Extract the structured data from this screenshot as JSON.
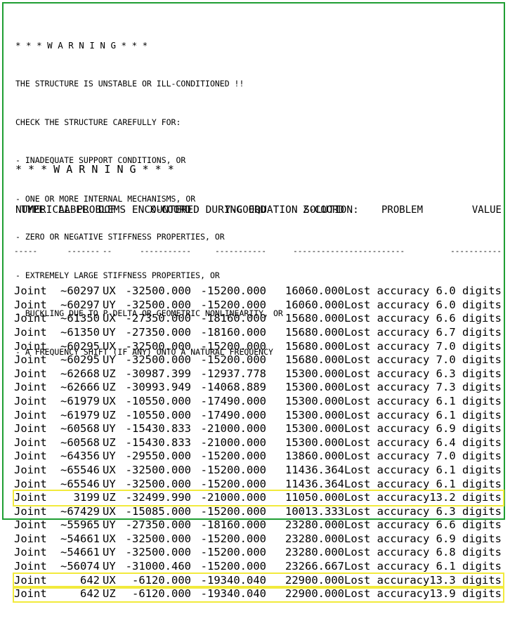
{
  "warning1": {
    "title": "* * * W A R N I N G * * *",
    "lines": [
      "THE STRUCTURE IS UNSTABLE OR ILL-CONDITIONED !!",
      "CHECK THE STRUCTURE CAREFULLY FOR:",
      "- INADEQUATE SUPPORT CONDITIONS, OR",
      "- ONE OR MORE INTERNAL MECHANISMS, OR",
      "- ZERO OR NEGATIVE STIFFNESS PROPERTIES, OR",
      "- EXTREMELY LARGE STIFFNESS PROPERTIES, OR",
      "- BUCKLING DUE TO P-DELTA OR GEOMETRIC NONLINEARITY, OR",
      "- A FREQUENCY SHIFT (IF ANY) ONTO A NATURAL FREQUENCY"
    ]
  },
  "warning2": {
    "title": "* * * W A R N I N G * * *",
    "message": "NUMERICAL PROBLEMS ENCOUNTERED DURING EQUATION SOLUTION:"
  },
  "table": {
    "headers": {
      "type": "TYPE",
      "label": "LABEL",
      "dof": "DOF",
      "x": "X-COORD",
      "y": "Y-COORD",
      "z": "Z-COORD",
      "problem": "PROBLEM",
      "value": "VALUE"
    },
    "separator": {
      "type": "-----",
      "label": "-------",
      "dof": "--",
      "x": "-----------",
      "y": "-----------",
      "z": "-----------",
      "problem": "-------------",
      "value": "-----------"
    },
    "rows": [
      {
        "type": "Joint",
        "label": "~60297",
        "dof": "UX",
        "x": "-32500.000",
        "y": "-15200.000",
        "z": "16060.000",
        "problem": "Lost accuracy",
        "value": "6.0 digits",
        "highlight": false
      },
      {
        "type": "Joint",
        "label": "~60297",
        "dof": "UY",
        "x": "-32500.000",
        "y": "-15200.000",
        "z": "16060.000",
        "problem": "Lost accuracy",
        "value": "6.0 digits",
        "highlight": false
      },
      {
        "type": "Joint",
        "label": "~61350",
        "dof": "UX",
        "x": "-27350.000",
        "y": "-18160.000",
        "z": "15680.000",
        "problem": "Lost accuracy",
        "value": "6.6 digits",
        "highlight": false
      },
      {
        "type": "Joint",
        "label": "~61350",
        "dof": "UY",
        "x": "-27350.000",
        "y": "-18160.000",
        "z": "15680.000",
        "problem": "Lost accuracy",
        "value": "6.7 digits",
        "highlight": false
      },
      {
        "type": "Joint",
        "label": "~60295",
        "dof": "UX",
        "x": "-32500.000",
        "y": "-15200.000",
        "z": "15680.000",
        "problem": "Lost accuracy",
        "value": "7.0 digits",
        "highlight": false
      },
      {
        "type": "Joint",
        "label": "~60295",
        "dof": "UY",
        "x": "-32500.000",
        "y": "-15200.000",
        "z": "15680.000",
        "problem": "Lost accuracy",
        "value": "7.0 digits",
        "highlight": false
      },
      {
        "type": "Joint",
        "label": "~62668",
        "dof": "UZ",
        "x": "-30987.399",
        "y": "-12937.778",
        "z": "15300.000",
        "problem": "Lost accuracy",
        "value": "6.3 digits",
        "highlight": false
      },
      {
        "type": "Joint",
        "label": "~62666",
        "dof": "UZ",
        "x": "-30993.949",
        "y": "-14068.889",
        "z": "15300.000",
        "problem": "Lost accuracy",
        "value": "7.3 digits",
        "highlight": false
      },
      {
        "type": "Joint",
        "label": "~61979",
        "dof": "UX",
        "x": "-10550.000",
        "y": "-17490.000",
        "z": "15300.000",
        "problem": "Lost accuracy",
        "value": "6.1 digits",
        "highlight": false
      },
      {
        "type": "Joint",
        "label": "~61979",
        "dof": "UZ",
        "x": "-10550.000",
        "y": "-17490.000",
        "z": "15300.000",
        "problem": "Lost accuracy",
        "value": "6.1 digits",
        "highlight": false
      },
      {
        "type": "Joint",
        "label": "~60568",
        "dof": "UY",
        "x": "-15430.833",
        "y": "-21000.000",
        "z": "15300.000",
        "problem": "Lost accuracy",
        "value": "6.9 digits",
        "highlight": false
      },
      {
        "type": "Joint",
        "label": "~60568",
        "dof": "UZ",
        "x": "-15430.833",
        "y": "-21000.000",
        "z": "15300.000",
        "problem": "Lost accuracy",
        "value": "6.4 digits",
        "highlight": false
      },
      {
        "type": "Joint",
        "label": "~64356",
        "dof": "UY",
        "x": "-29550.000",
        "y": "-15200.000",
        "z": "13860.000",
        "problem": "Lost accuracy",
        "value": "7.0 digits",
        "highlight": false
      },
      {
        "type": "Joint",
        "label": "~65546",
        "dof": "UX",
        "x": "-32500.000",
        "y": "-15200.000",
        "z": "11436.364",
        "problem": "Lost accuracy",
        "value": "6.1 digits",
        "highlight": false
      },
      {
        "type": "Joint",
        "label": "~65546",
        "dof": "UY",
        "x": "-32500.000",
        "y": "-15200.000",
        "z": "11436.364",
        "problem": "Lost accuracy",
        "value": "6.1 digits",
        "highlight": false
      },
      {
        "type": "Joint",
        "label": "3199",
        "dof": "UZ",
        "x": "-32499.990",
        "y": "-21000.000",
        "z": "11050.000",
        "problem": "Lost accuracy",
        "value": "13.2 digits",
        "highlight": true
      },
      {
        "type": "Joint",
        "label": "~67429",
        "dof": "UX",
        "x": "-15085.000",
        "y": "-15200.000",
        "z": "10013.333",
        "problem": "Lost accuracy",
        "value": "6.3 digits",
        "highlight": false
      },
      {
        "type": "Joint",
        "label": "~55965",
        "dof": "UY",
        "x": "-27350.000",
        "y": "-18160.000",
        "z": "23280.000",
        "problem": "Lost accuracy",
        "value": "6.6 digits",
        "highlight": false
      },
      {
        "type": "Joint",
        "label": "~54661",
        "dof": "UX",
        "x": "-32500.000",
        "y": "-15200.000",
        "z": "23280.000",
        "problem": "Lost accuracy",
        "value": "6.9 digits",
        "highlight": false
      },
      {
        "type": "Joint",
        "label": "~54661",
        "dof": "UY",
        "x": "-32500.000",
        "y": "-15200.000",
        "z": "23280.000",
        "problem": "Lost accuracy",
        "value": "6.8 digits",
        "highlight": false
      },
      {
        "type": "Joint",
        "label": "~56074",
        "dof": "UY",
        "x": "-31000.460",
        "y": "-15200.000",
        "z": "23266.667",
        "problem": "Lost accuracy",
        "value": "6.1 digits",
        "highlight": false
      },
      {
        "type": "Joint",
        "label": "642",
        "dof": "UX",
        "x": "-6120.000",
        "y": "-19340.040",
        "z": "22900.000",
        "problem": "Lost accuracy",
        "value": "13.3 digits",
        "highlight": true
      },
      {
        "type": "Joint",
        "label": "642",
        "dof": "UZ",
        "x": "-6120.000",
        "y": "-19340.040",
        "z": "22900.000",
        "problem": "Lost accuracy",
        "value": "13.9 digits",
        "highlight": true
      }
    ]
  },
  "colors": {
    "frame": "#1f9e33",
    "highlight": "#f2ea3c",
    "text": "#000000"
  }
}
